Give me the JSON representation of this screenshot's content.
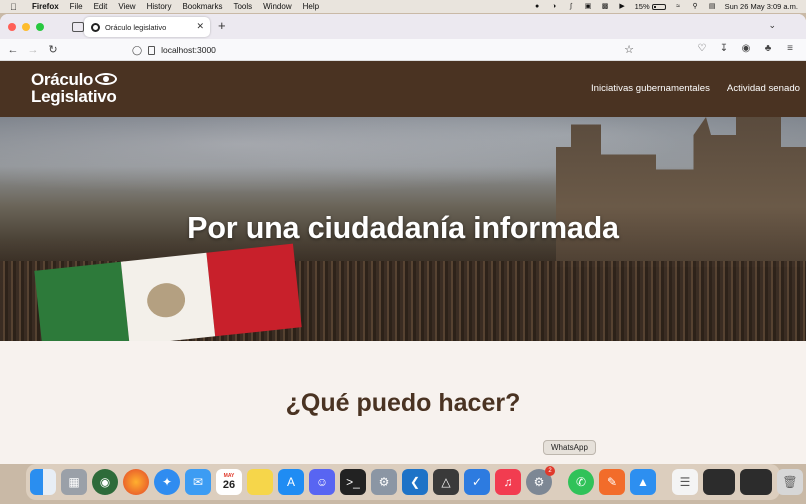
{
  "menubar": {
    "app_name": "Firefox",
    "menus": [
      "File",
      "Edit",
      "View",
      "History",
      "Bookmarks",
      "Tools",
      "Window",
      "Help"
    ],
    "battery": "15%",
    "datetime": "Sun 26 May  3:09 a.m."
  },
  "browser": {
    "tab_title": "Oráculo legislativo",
    "url": "localhost:3000"
  },
  "site": {
    "logo_line1": "Oráculo",
    "logo_line2": "Legislativo",
    "nav": [
      "Iniciativas gubernamentales",
      "Actividad senado"
    ],
    "hero_title": "Por una ciudadanía informada",
    "section_title": "¿Qué puedo hacer?"
  },
  "tooltip": "WhatsApp",
  "dock": {
    "calendar_month": "MAY",
    "calendar_day": "26",
    "settings_badge": "2",
    "apps": [
      "finder-icon",
      "launchpad-icon",
      "spotify-like-icon",
      "firefox-icon",
      "safari-icon",
      "mail-icon",
      "calendar-icon",
      "notes-icon",
      "app-store-icon",
      "discord-icon",
      "terminal-icon",
      "preview-icon",
      "vscode-icon",
      "unity-icon",
      "tasks-icon",
      "music-icon",
      "system-settings-icon",
      "whatsapp-icon",
      "pencil-app-icon",
      "keynote-icon",
      "document-icon",
      "window-thumb-icon",
      "window-thumb-icon",
      "trash-icon"
    ]
  }
}
